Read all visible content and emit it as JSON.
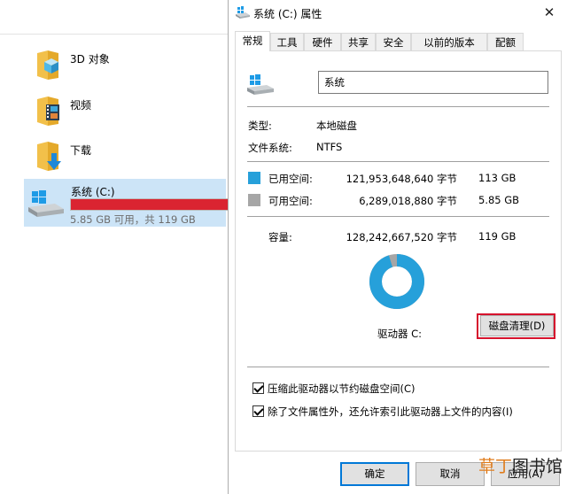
{
  "explorer": {
    "items": [
      {
        "label": "3D 对象",
        "icon": "folder-3d-objects-icon"
      },
      {
        "label": "视频",
        "icon": "folder-videos-icon"
      },
      {
        "label": "下载",
        "icon": "folder-downloads-icon"
      }
    ],
    "drive": {
      "name": "系统 (C:)",
      "info": "5.85 GB 可用，共 119 GB",
      "used_fraction": 0.951,
      "bar_color": "#da2431",
      "icon": "windows-drive-icon"
    }
  },
  "dialog": {
    "title": "系统 (C:) 属性",
    "close_glyph": "✕",
    "tabs": [
      "常规",
      "工具",
      "硬件",
      "共享",
      "安全",
      "以前的版本",
      "配额"
    ],
    "active_tab": "常规",
    "name_value": "系统",
    "type_label": "类型:",
    "type_value": "本地磁盘",
    "fs_label": "文件系统:",
    "fs_value": "NTFS",
    "used": {
      "label": "已用空间:",
      "bytes": "121,953,648,640 字节",
      "size": "113 GB",
      "color": "#26a0da"
    },
    "free": {
      "label": "可用空间:",
      "bytes": "6,289,018,880 字节",
      "size": "5.85 GB",
      "color": "#a6a6a6"
    },
    "capacity": {
      "label": "容量:",
      "bytes": "128,242,667,520 字节",
      "size": "119 GB"
    },
    "drive_label": "驱动器 C:",
    "cleanup_button": "磁盘清理(D)",
    "compress_checkbox": "压缩此驱动器以节约磁盘空间(C)",
    "index_checkbox": "除了文件属性外，还允许索引此驱动器上文件的内容(I)",
    "compress_checked": true,
    "index_checked": true,
    "buttons": {
      "ok": "确定",
      "cancel": "取消",
      "apply": "应用(A)"
    }
  },
  "watermark": {
    "part_a": "草丁",
    "part_b": "图书馆"
  }
}
